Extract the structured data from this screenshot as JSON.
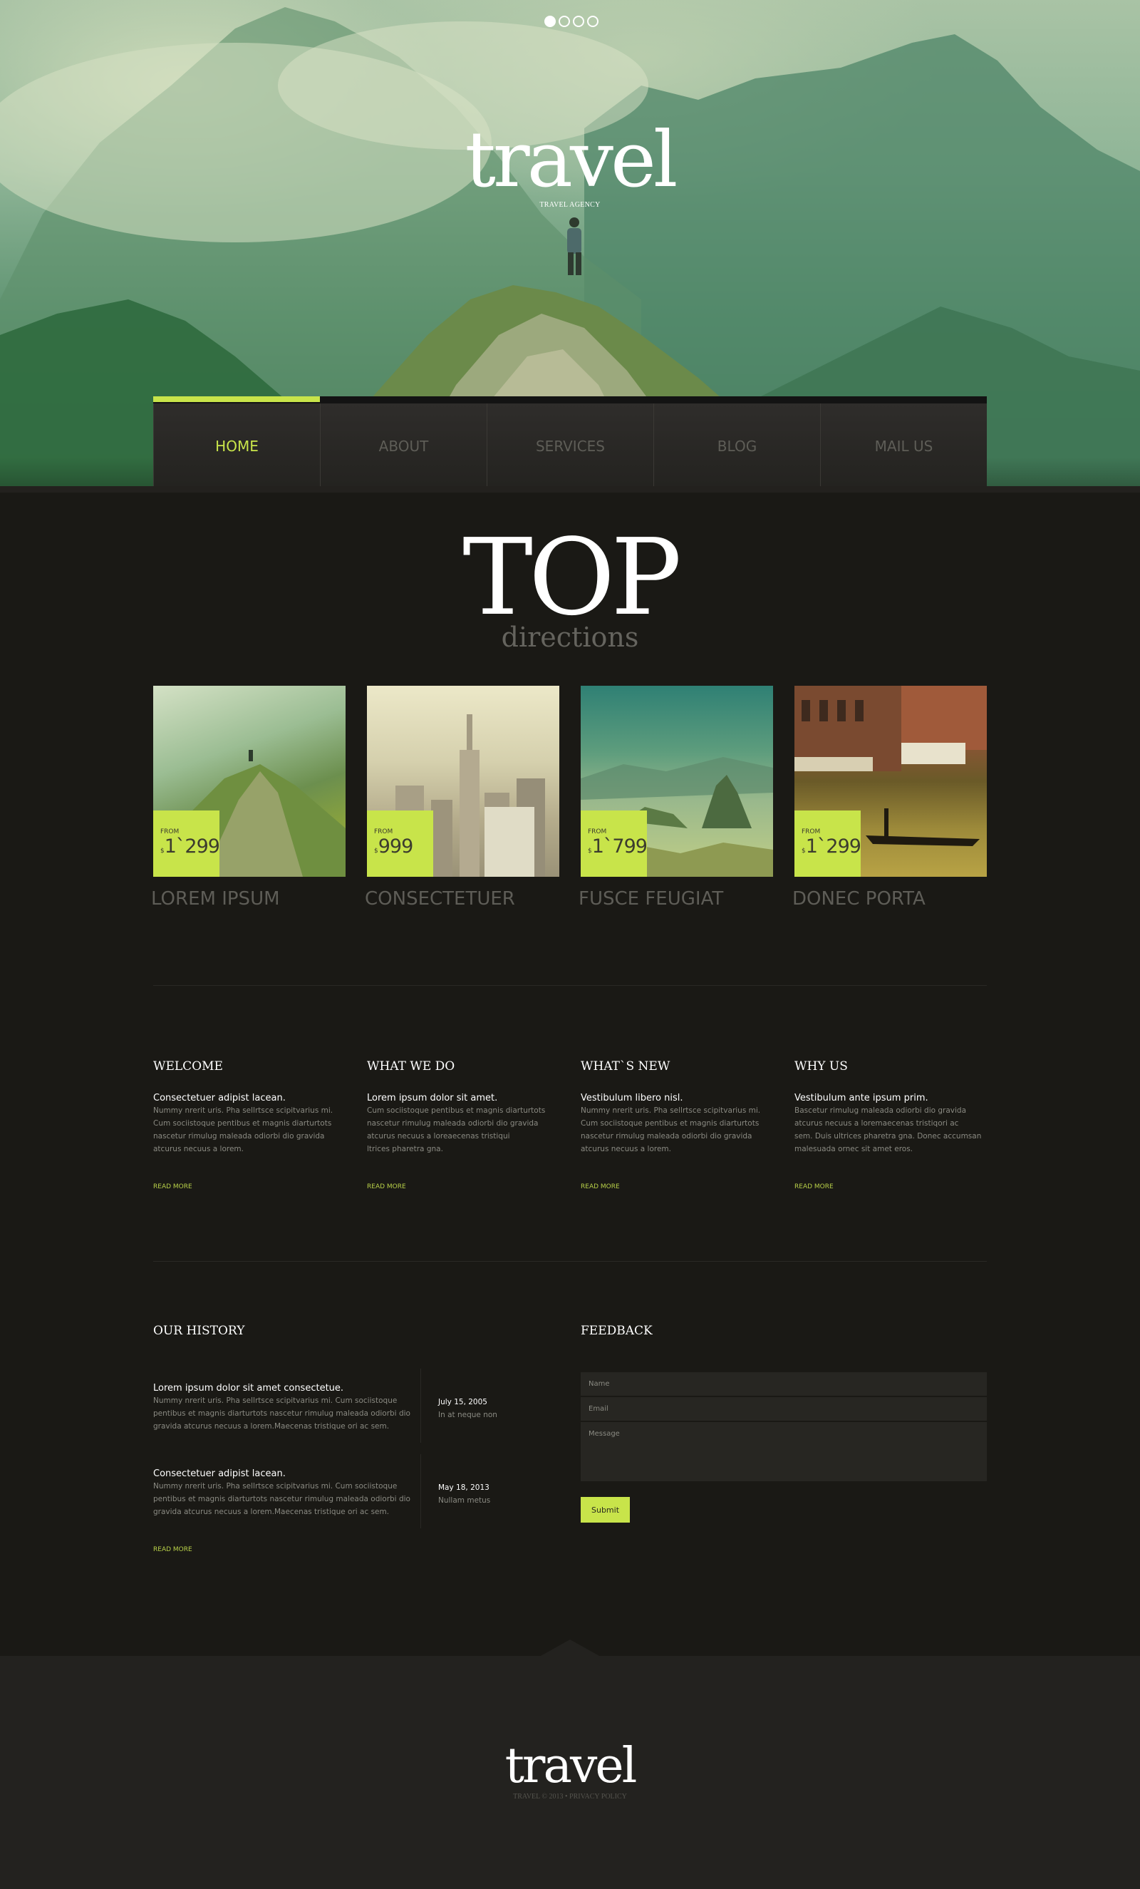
{
  "hero": {
    "slider_dots": [
      {
        "active": true
      },
      {
        "active": false
      },
      {
        "active": false
      },
      {
        "active": false
      }
    ],
    "logo": "travel",
    "tagline": "TRAVEL AGENCY"
  },
  "nav": {
    "items": [
      {
        "label": "HOME",
        "active": true
      },
      {
        "label": "ABOUT",
        "active": false
      },
      {
        "label": "SERVICES",
        "active": false
      },
      {
        "label": "BLOG",
        "active": false
      },
      {
        "label": "MAIL US",
        "active": false
      }
    ],
    "accent_color": "#c8e44a"
  },
  "top_directions": {
    "title": "TOP",
    "subtitle": "directions",
    "cards": [
      {
        "title": "LOREM IPSUM",
        "price_from": "FROM",
        "currency": "$",
        "price": "1`299",
        "image": "mountain-hiker"
      },
      {
        "title": "CONSECTETUER",
        "price_from": "FROM",
        "currency": "$",
        "price": "999",
        "image": "new-york-skyline"
      },
      {
        "title": "FUSCE FEUGIAT",
        "price_from": "FROM",
        "currency": "$",
        "price": "1`799",
        "image": "rio-sugarloaf"
      },
      {
        "title": "DONEC PORTA",
        "price_from": "FROM",
        "currency": "$",
        "price": "1`299",
        "image": "venice-gondola"
      }
    ]
  },
  "info_columns": [
    {
      "heading": "WELCOME",
      "lead": "Consectetuer adipist lacean.",
      "body": "Nummy nrerit uris. Pha sellrtsce scipitvarius mi.\nCum sociistoque pentibus et magnis diarturtots\nnascetur rimulug maleada odiorbi dio gravida\natcurus necuus a lorem.",
      "link": "READ MORE"
    },
    {
      "heading": "WHAT WE DO",
      "lead": "Lorem ipsum dolor sit amet.",
      "body": "Cum sociistoque pentibus et magnis diarturtots\nnascetur rimulug maleada odiorbi dio gravida\natcurus necuus a loreaecenas tristiqui\nltrices pharetra gna.",
      "link": "READ MORE"
    },
    {
      "heading": "WHAT`S NEW",
      "lead": "Vestibulum libero nisl.",
      "body": "Nummy nrerit uris. Pha sellrtsce scipitvarius mi.\nCum sociistoque pentibus et magnis diarturtots\nnascetur rimulug maleada odiorbi dio gravida\natcurus necuus a lorem.",
      "link": "READ MORE"
    },
    {
      "heading": "WHY US",
      "lead": "Vestibulum ante ipsum prim.",
      "body": "Bascetur rimulug maleada odiorbi dio gravida\natcurus necuus a loremaecenas tristiqori ac\nsem. Duis ultrices pharetra gna. Donec accumsan\nmalesuada ornec sit amet eros.",
      "link": "READ MORE"
    }
  ],
  "history": {
    "heading": "OUR HISTORY",
    "items": [
      {
        "lead": "Lorem ipsum dolor sit amet consectetue.",
        "body": "Nummy nrerit uris. Pha sellrtsce scipitvarius mi. Cum sociistoque pentibus et magnis diarturtots nascetur rimulug maleada odiorbi dio gravida atcurus necuus a lorem.Maecenas tristique ori ac sem.",
        "date": "July 15, 2005",
        "note": "In at neque non"
      },
      {
        "lead": "Consectetuer adipist lacean.",
        "body": "Nummy nrerit uris. Pha sellrtsce scipitvarius mi. Cum sociistoque pentibus et magnis diarturtots nascetur rimulug maleada odiorbi dio gravida atcurus necuus a lorem.Maecenas tristique ori ac sem.",
        "date": "May 18, 2013",
        "note": "Nullam metus"
      }
    ],
    "link": "READ MORE"
  },
  "feedback": {
    "heading": "FEEDBACK",
    "name_placeholder": "Name",
    "email_placeholder": "Email",
    "message_placeholder": "Message",
    "name_value": "",
    "email_value": "",
    "message_value": "",
    "submit_label": "Submit"
  },
  "footer": {
    "logo": "travel",
    "copyright": "TRAVEL © 2013",
    "separator": "•",
    "privacy_link": "PRIVACY POLICY"
  }
}
